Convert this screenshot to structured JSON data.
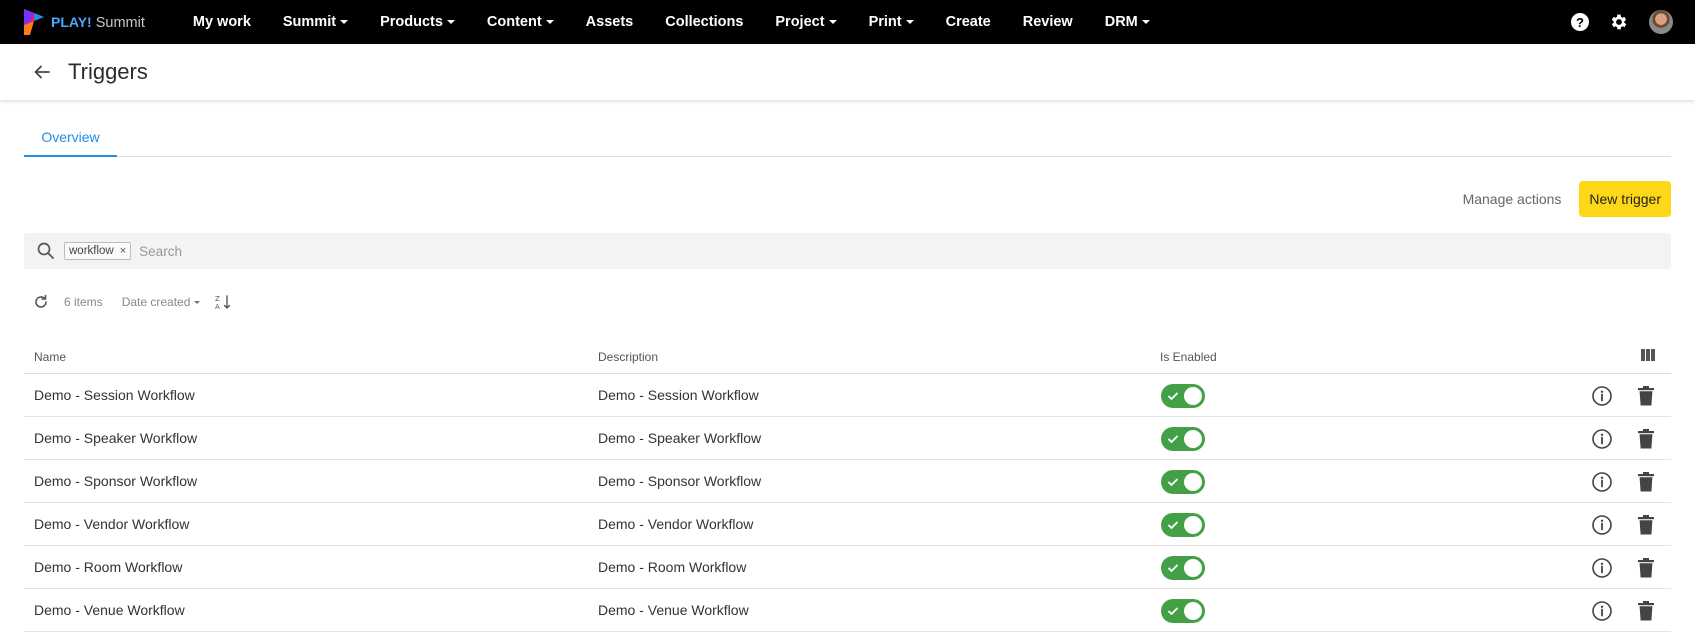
{
  "app": {
    "brand_play": "PLAY!",
    "brand_summit": "Summit"
  },
  "nav": {
    "items": [
      {
        "label": "My work",
        "dropdown": false
      },
      {
        "label": "Summit",
        "dropdown": true
      },
      {
        "label": "Products",
        "dropdown": true
      },
      {
        "label": "Content",
        "dropdown": true
      },
      {
        "label": "Assets",
        "dropdown": false
      },
      {
        "label": "Collections",
        "dropdown": false
      },
      {
        "label": "Project",
        "dropdown": true
      },
      {
        "label": "Print",
        "dropdown": true
      },
      {
        "label": "Create",
        "dropdown": false
      },
      {
        "label": "Review",
        "dropdown": false
      },
      {
        "label": "DRM",
        "dropdown": true
      }
    ],
    "help_glyph": "?"
  },
  "header": {
    "title": "Triggers"
  },
  "tabs": [
    {
      "label": "Overview",
      "active": true
    }
  ],
  "actions": {
    "manage_label": "Manage actions",
    "new_label": "New trigger"
  },
  "search": {
    "chip": "workflow",
    "chip_close": "×",
    "placeholder": "Search",
    "value": ""
  },
  "toolbar": {
    "count": "6 items",
    "sort_by": "Date created"
  },
  "table": {
    "columns": {
      "name": "Name",
      "description": "Description",
      "enabled": "Is Enabled"
    },
    "rows": [
      {
        "name": "Demo - Session Workflow",
        "description": "Demo - Session Workflow",
        "enabled": true
      },
      {
        "name": "Demo - Speaker Workflow",
        "description": "Demo - Speaker Workflow",
        "enabled": true
      },
      {
        "name": "Demo - Sponsor Workflow",
        "description": "Demo - Sponsor Workflow",
        "enabled": true
      },
      {
        "name": "Demo - Vendor Workflow",
        "description": "Demo - Vendor Workflow",
        "enabled": true
      },
      {
        "name": "Demo - Room Workflow",
        "description": "Demo - Room Workflow",
        "enabled": true
      },
      {
        "name": "Demo - Venue Workflow",
        "description": "Demo - Venue Workflow",
        "enabled": true
      }
    ]
  },
  "colors": {
    "accent": "#1f8fe6",
    "primary_button": "#fdd817",
    "toggle_on": "#43a047",
    "topbar": "#000000"
  }
}
